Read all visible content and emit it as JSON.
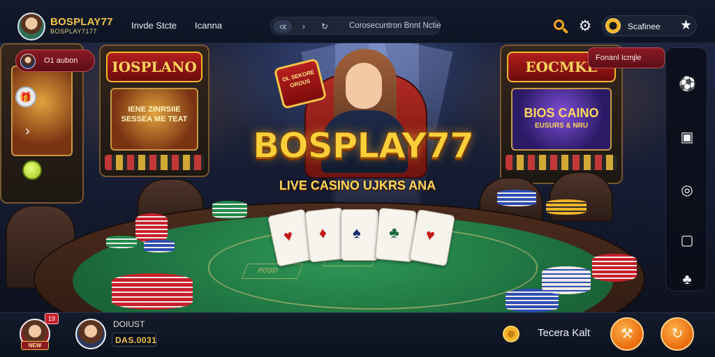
{
  "header": {
    "brand_title": "BOSPLAY77",
    "brand_subtitle": "BOSPLAY7177",
    "nav": [
      "Invde Stcte",
      "Icanna"
    ],
    "url_controls": [
      "‹x",
      "›",
      "↻"
    ],
    "url_text": "Corosecuntron Bnnt Nctie",
    "icons": [
      "search-icon",
      "gear-icon",
      "star-icon"
    ],
    "account_label": "Scafinee"
  },
  "scene": {
    "hero_title": "BOSPLAY77",
    "hero_subtitle": "LIVE CASINO UJKRS ANA",
    "left_pill_text": "O1 aubon",
    "right_pill_text": "Fonanl Icmjle",
    "promo_sign_text": "OL SEKORE OROUS",
    "arcade_left_marquee": "IOSPLANO",
    "arcade_left_screen": "IENE ZINRSIIE SESSEA ME TEAT",
    "arcade_right_marquee": "EOCMKE",
    "arcade_right_screen": "BIOS CAINO",
    "arcade_right_screen_sub": "EUSURS & NRU",
    "felt_box_label": "POSD",
    "rail_icons": [
      "soccer-ball-icon",
      "slot-machine-icon",
      "spin-icon",
      "chat-icon",
      "cards-icon"
    ]
  },
  "footer": {
    "mini_badge": "19",
    "under_badge": "NEW",
    "player_name": "DOIUST",
    "player_balance": "DAS.0031",
    "bottom_label": "Tecera Kalt",
    "buttons": [
      "deposit-button-icon",
      "refresh-button-icon"
    ]
  },
  "colors": {
    "accent_gold": "#f5c448",
    "accent_orange": "#ea6a0c",
    "accent_red": "#8b1a24",
    "felt_green": "#1d6d3d"
  }
}
